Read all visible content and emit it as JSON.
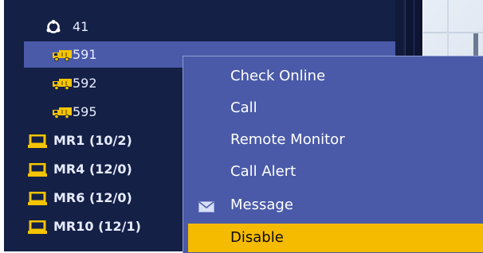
{
  "tree": {
    "items": [
      {
        "label": "41",
        "icon": "group-icon",
        "bold": false,
        "selected": false
      },
      {
        "label": "591",
        "icon": "truck-icon",
        "bold": false,
        "selected": true
      },
      {
        "label": "592",
        "icon": "truck-icon",
        "bold": false,
        "selected": false
      },
      {
        "label": "595",
        "icon": "truck-icon",
        "bold": false,
        "selected": false
      },
      {
        "label": "MR1 (10/2)",
        "icon": "laptop-icon",
        "bold": true,
        "selected": false
      },
      {
        "label": "MR4 (12/0)",
        "icon": "laptop-icon",
        "bold": true,
        "selected": false
      },
      {
        "label": "MR6 (12/0)",
        "icon": "laptop-icon",
        "bold": true,
        "selected": false
      },
      {
        "label": "MR10 (12/1)",
        "icon": "laptop-icon",
        "bold": true,
        "selected": false
      }
    ]
  },
  "context_menu": {
    "items": [
      {
        "label": "Check Online",
        "icon": null,
        "highlighted": false
      },
      {
        "label": "Call",
        "icon": null,
        "highlighted": false
      },
      {
        "label": "Remote Monitor",
        "icon": null,
        "highlighted": false
      },
      {
        "label": "Call Alert",
        "icon": null,
        "highlighted": false
      },
      {
        "label": "Message",
        "icon": "envelope-icon",
        "highlighted": false
      },
      {
        "label": "Disable",
        "icon": null,
        "highlighted": true
      }
    ]
  },
  "colors": {
    "tree_bg": "#142045",
    "menu_bg": "#4a5aa8",
    "highlight": "#f5bb00",
    "icon_yellow": "#f5c400"
  }
}
